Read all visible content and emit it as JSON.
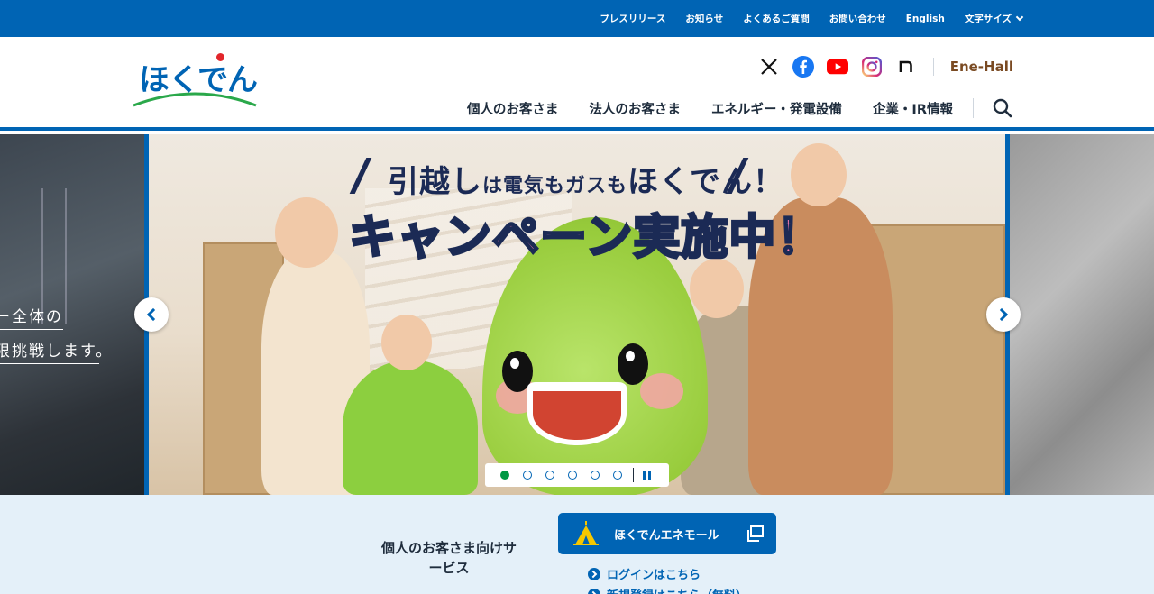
{
  "topbar": {
    "links": [
      {
        "label": "プレスリリース"
      },
      {
        "label": "お知らせ"
      },
      {
        "label": "よくあるご質問"
      },
      {
        "label": "お問い合わせ"
      },
      {
        "label": "English"
      },
      {
        "label": "文字サイズ"
      }
    ]
  },
  "header": {
    "logo_text": "ほくでん",
    "enehall": "Ene-Hall",
    "nav": [
      {
        "label": "個人のお客さま"
      },
      {
        "label": "法人のお客さま"
      },
      {
        "label": "エネルギー・発電設備"
      },
      {
        "label": "企業・IR情報"
      }
    ]
  },
  "hero": {
    "prev_slide_line1": "ー全体の",
    "prev_slide_line2": "限挑戦します。",
    "title_part1": "引越し",
    "title_small1": "は電気もガスも",
    "title_part2": "ほくでん！",
    "campaign_pink": "キャンペーン",
    "campaign_blue": "実施中",
    "campaign_end": "！",
    "slide_count": 6,
    "active_slide": 1
  },
  "services": {
    "title": "個人のお客さま向けサービス",
    "enemall_label": "ほくでんエネモール",
    "links": [
      {
        "label": "ログインはこちら"
      },
      {
        "label": "新規登録はこちら（無料）"
      }
    ]
  },
  "colors": {
    "brand_blue": "#0064b4",
    "active_dot": "#009944",
    "logo_red": "#e2262b"
  }
}
